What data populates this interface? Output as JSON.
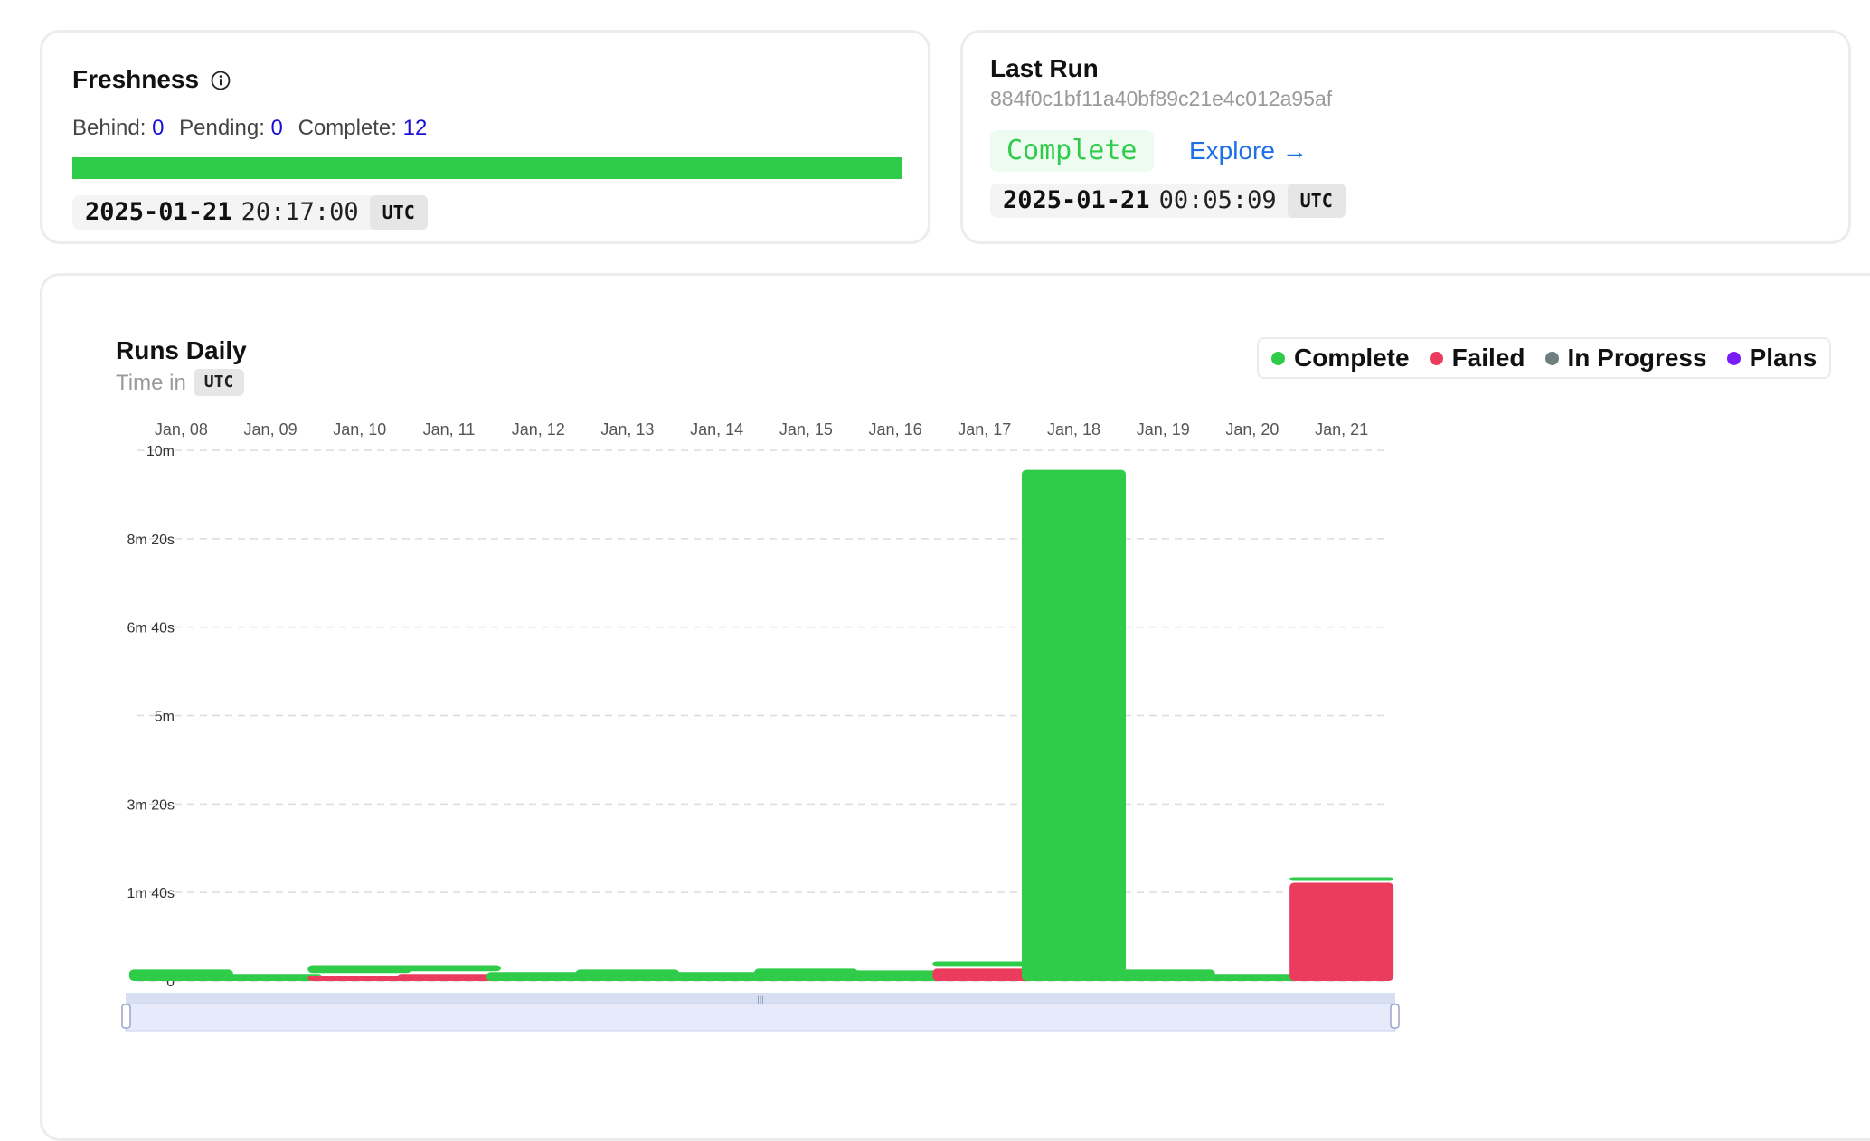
{
  "freshness": {
    "title": "Freshness",
    "behind_label": "Behind:",
    "behind_value": "0",
    "pending_label": "Pending:",
    "pending_value": "0",
    "complete_label": "Complete:",
    "complete_value": "12",
    "progress_fraction": 1.0,
    "progress_color": "#2ecc48",
    "timestamp_date": "2025-01-21",
    "timestamp_time": "20:17:00",
    "timezone": "UTC"
  },
  "last_run": {
    "title": "Last Run",
    "run_id": "884f0c1bf11a40bf89c21e4c012a95af",
    "status": "Complete",
    "status_color": "#2ecc48",
    "explore_label": "Explore →",
    "timestamp_date": "2025-01-21",
    "timestamp_time": "00:05:09",
    "timezone": "UTC"
  },
  "chart_header": {
    "title": "Runs Daily",
    "time_in_label": "Time in",
    "timezone": "UTC"
  },
  "legend": [
    {
      "label": "Complete",
      "color": "#2ecc48"
    },
    {
      "label": "Failed",
      "color": "#ec3c5e"
    },
    {
      "label": "In Progress",
      "color": "#6f7f7f"
    },
    {
      "label": "Plans",
      "color": "#7a1cf5"
    }
  ],
  "chart_data": {
    "type": "bar",
    "title": "Runs Daily",
    "xlabel": "",
    "ylabel": "",
    "x_axis_position": "top",
    "categories": [
      "Jan, 08",
      "Jan, 09",
      "Jan, 10",
      "Jan, 11",
      "Jan, 12",
      "Jan, 13",
      "Jan, 14",
      "Jan, 15",
      "Jan, 16",
      "Jan, 17",
      "Jan, 18",
      "Jan, 19",
      "Jan, 20",
      "Jan, 21"
    ],
    "y_unit": "seconds",
    "ylim": [
      0,
      600
    ],
    "yticks": [
      {
        "value": 0,
        "label": "0"
      },
      {
        "value": 100,
        "label": "1m 40s"
      },
      {
        "value": 200,
        "label": "3m 20s"
      },
      {
        "value": 300,
        "label": "5m"
      },
      {
        "value": 400,
        "label": "6m 40s"
      },
      {
        "value": 500,
        "label": "8m 20s"
      },
      {
        "value": 600,
        "label": "10m"
      }
    ],
    "grid": true,
    "legend_position": "top-right",
    "series": [
      {
        "name": "Failed",
        "color": "#ec3c5e",
        "values": [
          0,
          0,
          9,
          11,
          0,
          0,
          0,
          0,
          0,
          17,
          0,
          0,
          0,
          114
        ]
      },
      {
        "name": "Complete",
        "color": "#2ecc48",
        "values": [
          16,
          11,
          12,
          10,
          13,
          16,
          13,
          17,
          15,
          8,
          581,
          16,
          11,
          6
        ]
      }
    ]
  }
}
